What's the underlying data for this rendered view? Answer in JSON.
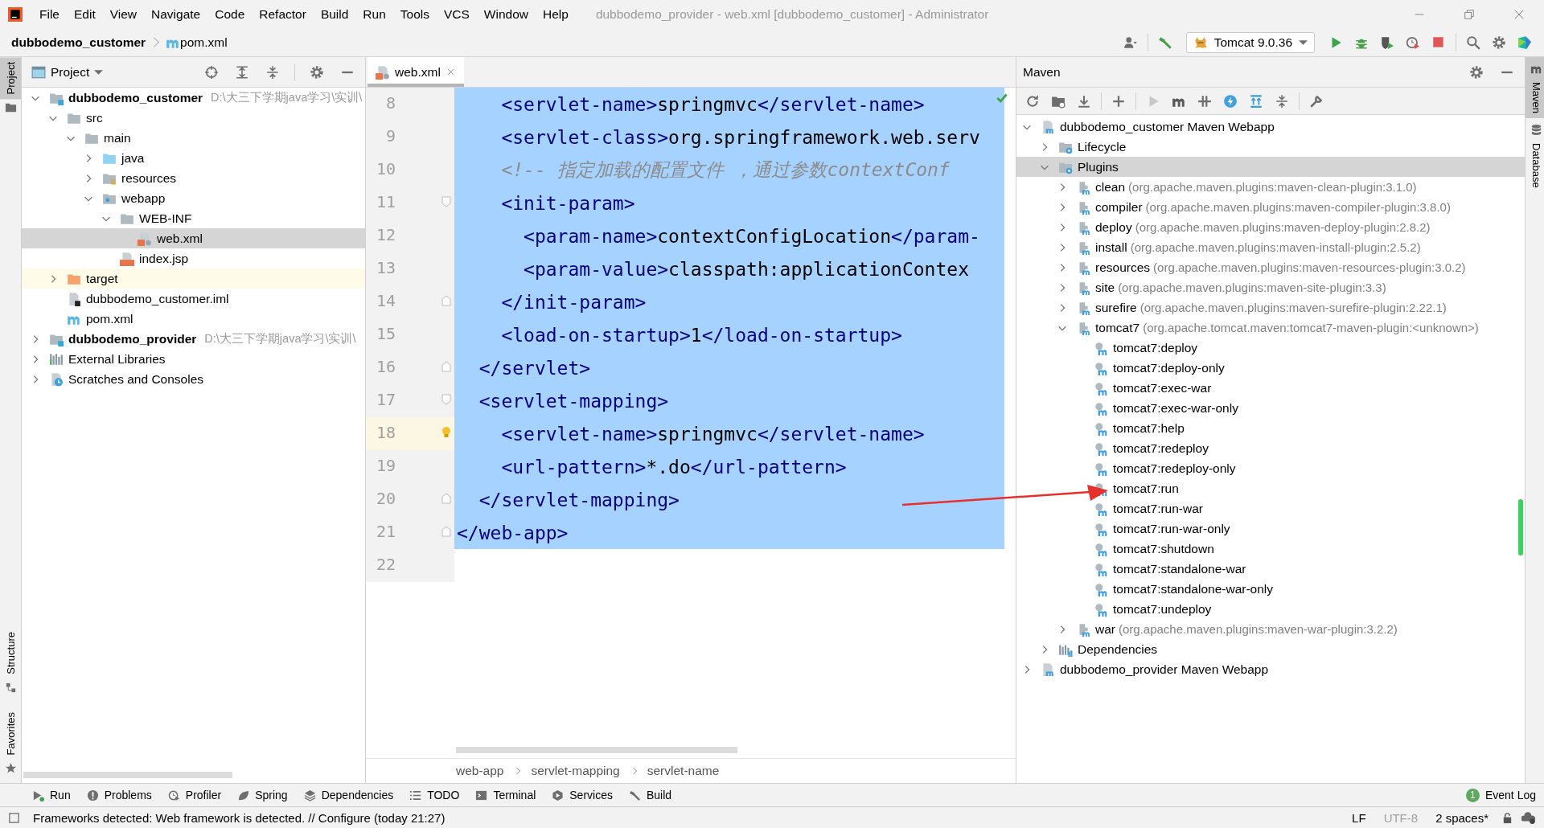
{
  "menu_bar": {
    "items": [
      "File",
      "Edit",
      "View",
      "Navigate",
      "Code",
      "Refactor",
      "Build",
      "Run",
      "Tools",
      "VCS",
      "Window",
      "Help"
    ],
    "title": "dubbodemo_provider - web.xml [dubbodemo_customer] - Administrator"
  },
  "nav_bar": {
    "crumbs": [
      {
        "label": "dubbodemo_customer",
        "kind": "module"
      },
      {
        "label": "pom.xml",
        "kind": "maven"
      }
    ],
    "run_config": "Tomcat 9.0.36"
  },
  "left_stripe": {
    "top": [
      {
        "label": "Project",
        "selected": true
      }
    ],
    "bottom": [
      {
        "label": "Structure",
        "selected": false
      },
      {
        "label": "Favorites",
        "selected": false
      }
    ]
  },
  "project_panel": {
    "title": "Project",
    "tree": [
      {
        "label": "dubbodemo_customer",
        "path": "D:\\大三下学期java学习\\实训\\",
        "kind": "module",
        "expanded": true,
        "selected": false,
        "children": [
          {
            "label": "src",
            "kind": "folder",
            "expanded": true,
            "selected": false,
            "children": [
              {
                "label": "main",
                "kind": "folder",
                "expanded": true,
                "selected": false,
                "children": [
                  {
                    "label": "java",
                    "kind": "source",
                    "expanded": false,
                    "selected": false
                  },
                  {
                    "label": "resources",
                    "kind": "resources",
                    "expanded": false,
                    "selected": false
                  },
                  {
                    "label": "webapp",
                    "kind": "web",
                    "expanded": true,
                    "selected": false,
                    "children": [
                      {
                        "label": "WEB-INF",
                        "kind": "folder",
                        "expanded": true,
                        "selected": false,
                        "children": [
                          {
                            "label": "web.xml",
                            "kind": "xml",
                            "selected": true
                          }
                        ]
                      },
                      {
                        "label": "index.jsp",
                        "kind": "jsp",
                        "selected": false
                      }
                    ]
                  }
                ]
              }
            ]
          },
          {
            "label": "target",
            "kind": "excluded",
            "expanded": false,
            "selected": false
          },
          {
            "label": "dubbodemo_customer.iml",
            "kind": "iml",
            "selected": false
          },
          {
            "label": "pom.xml",
            "kind": "maven",
            "selected": false
          }
        ]
      },
      {
        "label": "dubbodemo_provider",
        "path": "D:\\大三下学期java学习\\实训\\",
        "kind": "module",
        "expanded": false,
        "selected": false
      },
      {
        "label": "External Libraries",
        "kind": "library",
        "expanded": false,
        "selected": false
      },
      {
        "label": "Scratches and Consoles",
        "kind": "scratches",
        "expanded": false,
        "selected": false
      }
    ]
  },
  "editor": {
    "tab": {
      "label": "web.xml",
      "selected": true
    },
    "lines": [
      {
        "number": "8",
        "kind": "plain",
        "selected": true,
        "current": false,
        "segments": [
          {
            "kind": "tag",
            "text": "    <servlet-name>"
          },
          {
            "kind": "text",
            "text": "springmvc"
          },
          {
            "kind": "tag",
            "text": "</servlet-name>"
          }
        ]
      },
      {
        "number": "9",
        "kind": "plain",
        "selected": true,
        "current": false,
        "segments": [
          {
            "kind": "tag",
            "text": "    <servlet-class>"
          },
          {
            "kind": "text",
            "text": "org.springframework.web.serv"
          }
        ]
      },
      {
        "number": "10",
        "kind": "plain",
        "selected": true,
        "current": false,
        "segments": [
          {
            "kind": "comment",
            "text": "    <!-- 指定加载的配置文件 ，通过参数contextConf"
          }
        ]
      },
      {
        "number": "11",
        "kind": "fold-start",
        "selected": true,
        "current": false,
        "segments": [
          {
            "kind": "tag",
            "text": "    <init-param>"
          }
        ]
      },
      {
        "number": "12",
        "kind": "plain",
        "selected": true,
        "current": false,
        "segments": [
          {
            "kind": "tag",
            "text": "      <param-name>"
          },
          {
            "kind": "text",
            "text": "contextConfigLocation"
          },
          {
            "kind": "tag",
            "text": "</param-"
          }
        ]
      },
      {
        "number": "13",
        "kind": "plain",
        "selected": true,
        "current": false,
        "segments": [
          {
            "kind": "tag",
            "text": "      <param-value>"
          },
          {
            "kind": "text",
            "text": "classpath:applicationContex"
          }
        ]
      },
      {
        "number": "14",
        "kind": "fold-end",
        "selected": true,
        "current": false,
        "segments": [
          {
            "kind": "tag",
            "text": "    </init-param>"
          }
        ]
      },
      {
        "number": "15",
        "kind": "plain",
        "selected": true,
        "current": false,
        "segments": [
          {
            "kind": "tag",
            "text": "    <load-on-startup>"
          },
          {
            "kind": "text",
            "text": "1"
          },
          {
            "kind": "tag",
            "text": "</load-on-startup>"
          }
        ]
      },
      {
        "number": "16",
        "kind": "fold-end",
        "selected": true,
        "current": false,
        "segments": [
          {
            "kind": "tag",
            "text": "  </servlet>"
          }
        ]
      },
      {
        "number": "17",
        "kind": "fold-start",
        "selected": true,
        "current": false,
        "segments": [
          {
            "kind": "tag",
            "text": "  <servlet-mapping>"
          }
        ]
      },
      {
        "number": "18",
        "kind": "plain",
        "selected": true,
        "current": true,
        "segments": [
          {
            "kind": "tag",
            "text": "    <servlet-name>"
          },
          {
            "kind": "text",
            "text": "springmvc"
          },
          {
            "kind": "tag",
            "text": "</servlet-name>"
          }
        ]
      },
      {
        "number": "19",
        "kind": "plain",
        "selected": true,
        "current": false,
        "segments": [
          {
            "kind": "tag",
            "text": "    <url-pattern>"
          },
          {
            "kind": "text",
            "text": "*.do"
          },
          {
            "kind": "tag",
            "text": "</url-pattern>"
          }
        ]
      },
      {
        "number": "20",
        "kind": "fold-end",
        "selected": true,
        "current": false,
        "segments": [
          {
            "kind": "tag",
            "text": "  </servlet-mapping>"
          }
        ]
      },
      {
        "number": "21",
        "kind": "fold-end",
        "selected": true,
        "current": false,
        "segments": [
          {
            "kind": "tag",
            "text": "</web-app>"
          }
        ]
      },
      {
        "number": "22",
        "kind": "plain",
        "selected": false,
        "current": false
      }
    ],
    "breadcrumbs": [
      "web-app",
      "servlet-mapping",
      "servlet-name"
    ]
  },
  "maven_panel": {
    "title": "Maven",
    "tree": [
      {
        "label": "dubbodemo_customer Maven Webapp",
        "kind": "project",
        "expanded": true,
        "selected": false,
        "children": [
          {
            "label": "Lifecycle",
            "kind": "group",
            "expanded": false,
            "selected": false
          },
          {
            "label": "Plugins",
            "kind": "group",
            "expanded": true,
            "selected": true,
            "children": [
              {
                "label": "clean",
                "detail": "(org.apache.maven.plugins:maven-clean-plugin:3.1.0)",
                "kind": "plugin",
                "expanded": false,
                "selected": false
              },
              {
                "label": "compiler",
                "detail": "(org.apache.maven.plugins:maven-compiler-plugin:3.8.0)",
                "kind": "plugin",
                "expanded": false,
                "selected": false
              },
              {
                "label": "deploy",
                "detail": "(org.apache.maven.plugins:maven-deploy-plugin:2.8.2)",
                "kind": "plugin",
                "expanded": false,
                "selected": false
              },
              {
                "label": "install",
                "detail": "(org.apache.maven.plugins:maven-install-plugin:2.5.2)",
                "kind": "plugin",
                "expanded": false,
                "selected": false
              },
              {
                "label": "resources",
                "detail": "(org.apache.maven.plugins:maven-resources-plugin:3.0.2)",
                "kind": "plugin",
                "expanded": false,
                "selected": false
              },
              {
                "label": "site",
                "detail": "(org.apache.maven.plugins:maven-site-plugin:3.3)",
                "kind": "plugin",
                "expanded": false,
                "selected": false
              },
              {
                "label": "surefire",
                "detail": "(org.apache.maven.plugins:maven-surefire-plugin:2.22.1)",
                "kind": "plugin",
                "expanded": false,
                "selected": false
              },
              {
                "label": "tomcat7",
                "detail": "(org.apache.tomcat.maven:tomcat7-maven-plugin:<unknown>)",
                "kind": "plugin",
                "expanded": true,
                "selected": false,
                "children": [
                  {
                    "label": "tomcat7:deploy",
                    "kind": "goal",
                    "selected": false
                  },
                  {
                    "label": "tomcat7:deploy-only",
                    "kind": "goal",
                    "selected": false
                  },
                  {
                    "label": "tomcat7:exec-war",
                    "kind": "goal",
                    "selected": false
                  },
                  {
                    "label": "tomcat7:exec-war-only",
                    "kind": "goal",
                    "selected": false
                  },
                  {
                    "label": "tomcat7:help",
                    "kind": "goal",
                    "selected": false
                  },
                  {
                    "label": "tomcat7:redeploy",
                    "kind": "goal",
                    "selected": false
                  },
                  {
                    "label": "tomcat7:redeploy-only",
                    "kind": "goal",
                    "selected": false
                  },
                  {
                    "label": "tomcat7:run",
                    "kind": "goal",
                    "selected": false
                  },
                  {
                    "label": "tomcat7:run-war",
                    "kind": "goal",
                    "selected": false
                  },
                  {
                    "label": "tomcat7:run-war-only",
                    "kind": "goal",
                    "selected": false
                  },
                  {
                    "label": "tomcat7:shutdown",
                    "kind": "goal",
                    "selected": false
                  },
                  {
                    "label": "tomcat7:standalone-war",
                    "kind": "goal",
                    "selected": false
                  },
                  {
                    "label": "tomcat7:standalone-war-only",
                    "kind": "goal",
                    "selected": false
                  },
                  {
                    "label": "tomcat7:undeploy",
                    "kind": "goal",
                    "selected": false
                  }
                ]
              },
              {
                "label": "war",
                "detail": "(org.apache.maven.plugins:maven-war-plugin:3.2.2)",
                "kind": "plugin",
                "expanded": false,
                "selected": false
              }
            ]
          },
          {
            "label": "Dependencies",
            "kind": "deps",
            "expanded": false,
            "selected": false
          }
        ]
      },
      {
        "label": "dubbodemo_provider Maven Webapp",
        "kind": "project",
        "expanded": false,
        "selected": false
      }
    ]
  },
  "right_stripe": [
    {
      "label": "Maven",
      "selected": true
    },
    {
      "label": "Database",
      "selected": false
    }
  ],
  "tool_buttons": [
    {
      "label": "Run",
      "kind": "run"
    },
    {
      "label": "Problems",
      "kind": "problems"
    },
    {
      "label": "Profiler",
      "kind": "profiler"
    },
    {
      "label": "Spring",
      "kind": "spring"
    },
    {
      "label": "Dependencies",
      "kind": "dependencies"
    },
    {
      "label": "TODO",
      "kind": "todo"
    },
    {
      "label": "Terminal",
      "kind": "terminal"
    },
    {
      "label": "Services",
      "kind": "services"
    },
    {
      "label": "Build",
      "kind": "build"
    }
  ],
  "event_log": {
    "label": "Event Log",
    "count": "1"
  },
  "status_bar": {
    "message": "Frameworks detected: Web framework is detected. // Configure (today 21:27)",
    "items": [
      {
        "label": "LF",
        "disabled": false
      },
      {
        "label": "UTF-8",
        "disabled": true
      },
      {
        "label": "2 spaces*",
        "disabled": false
      }
    ]
  }
}
